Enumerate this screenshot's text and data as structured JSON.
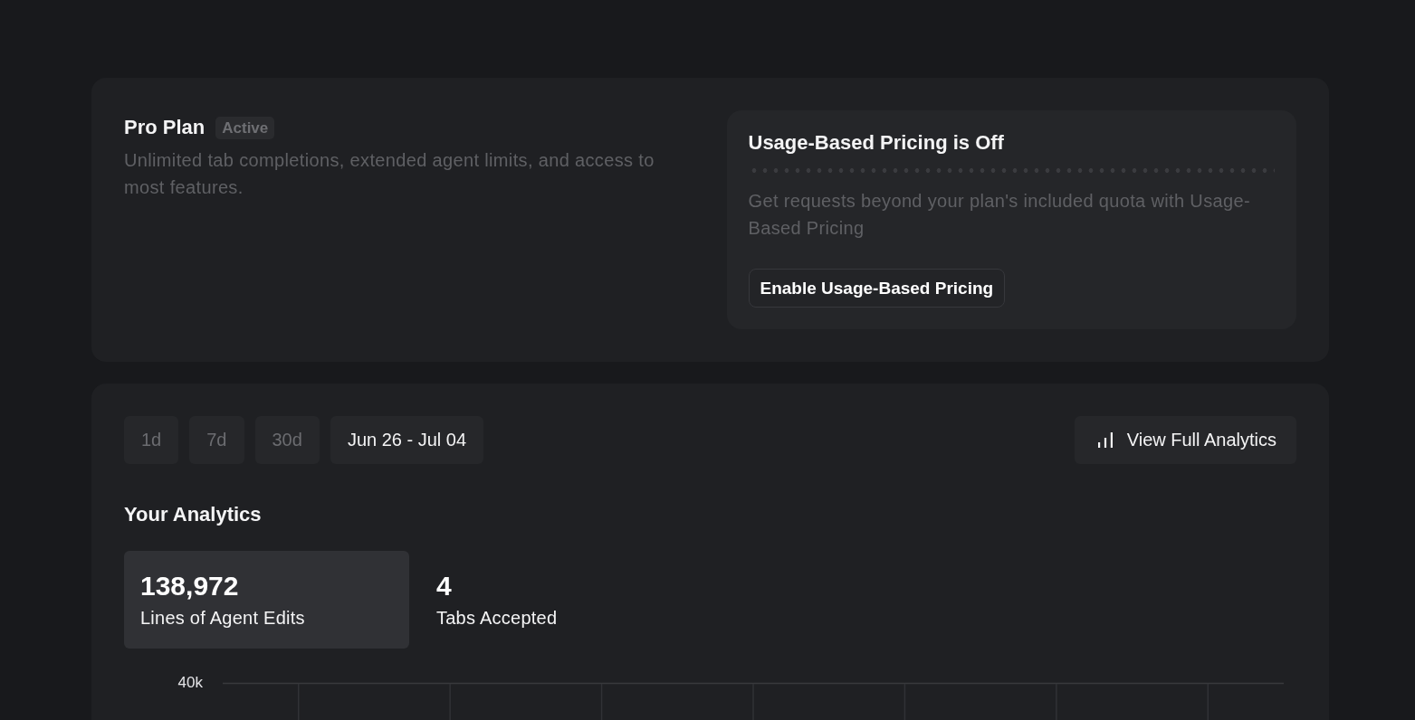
{
  "plan": {
    "title": "Pro Plan",
    "badge": "Active",
    "description": "Unlimited tab completions, extended agent limits, and access to most features."
  },
  "usage_pricing": {
    "title": "Usage-Based Pricing is Off",
    "description": "Get requests beyond your plan's included quota with Usage-Based Pricing",
    "button": "Enable Usage-Based Pricing"
  },
  "range_tabs": [
    {
      "label": "1d",
      "selected": false
    },
    {
      "label": "7d",
      "selected": false
    },
    {
      "label": "30d",
      "selected": false
    },
    {
      "label": "Jun 26 - Jul 04",
      "selected": true
    }
  ],
  "analytics_button": "View Full Analytics",
  "analytics": {
    "title": "Your Analytics",
    "stats": [
      {
        "value": "138,972",
        "label": "Lines of Agent Edits",
        "selected": true
      },
      {
        "value": "4",
        "label": "Tabs Accepted",
        "selected": false
      }
    ]
  },
  "chart": {
    "y_tick": "40k"
  }
}
